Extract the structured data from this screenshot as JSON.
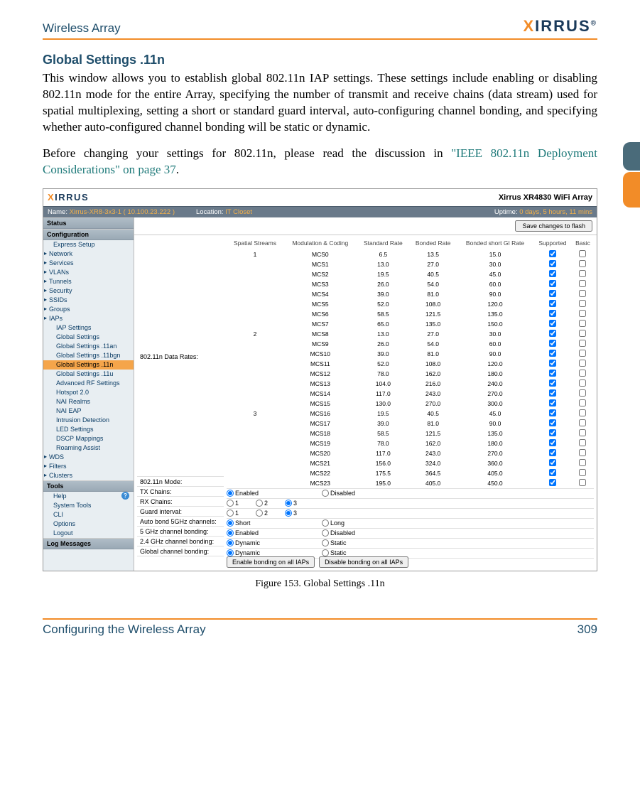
{
  "header": {
    "left": "Wireless Array",
    "brand_pre": "X",
    "brand_rest": "IRRUS",
    "brand_mark": "®"
  },
  "section_title": "Global Settings .11n",
  "para1": "This window allows you to establish global 802.11n IAP settings. These settings include enabling or disabling 802.11n mode for the entire Array, specifying the number of transmit and receive chains (data stream) used for spatial multiplexing, setting a short or standard guard interval, auto-configuring channel bonding, and specifying whether auto-configured channel bonding will be static or dynamic.",
  "para2_pre": "Before changing your settings for 802.11n, please read the discussion in ",
  "para2_link": "\"IEEE 802.11n Deployment Considerations\" on page 37",
  "para2_post": ".",
  "caption": "Figure 153. Global Settings .11n",
  "footer": {
    "left": "Configuring the Wireless Array",
    "right": "309"
  },
  "fig": {
    "title": "Xirrus XR4830 WiFi Array",
    "brand_pre": "X",
    "brand_rest": "IRRUS",
    "status": {
      "name_lbl": "Name:",
      "name_val": "Xirrus-XR8-3x3-1   ( 10.100.23.222 )",
      "loc_lbl": "Location:",
      "loc_val": "IT Closet",
      "up_lbl": "Uptime:",
      "up_val": "0 days, 5 hours, 11 mins"
    },
    "save_btn": "Save changes to flash",
    "sidebar": {
      "hdr1": "Status",
      "hdr2": "Configuration",
      "hdr3": "Tools",
      "hdr4": "Log Messages",
      "config_top": [
        "Express Setup"
      ],
      "config_primary": [
        "Network",
        "Services",
        "VLANs",
        "Tunnels",
        "Security",
        "SSIDs",
        "Groups",
        "IAPs"
      ],
      "iap_sub": [
        "IAP Settings",
        "Global Settings",
        "Global Settings .11an",
        "Global Settings .11bgn",
        "Global Settings .11n",
        "Global Settings .11u",
        "Advanced RF Settings",
        "Hotspot 2.0",
        "NAI Realms",
        "NAI EAP",
        "Intrusion Detection",
        "LED Settings",
        "DSCP Mappings",
        "Roaming Assist"
      ],
      "after_iaps": [
        "WDS",
        "Filters",
        "Clusters"
      ],
      "tools": [
        "Help",
        "System Tools",
        "CLI",
        "Options",
        "Logout"
      ]
    },
    "rates_label": "802.11n Data Rates:",
    "headers": [
      "Spatial Streams",
      "Modulation & Coding",
      "Standard Rate",
      "Bonded Rate",
      "Bonded short GI Rate",
      "Supported",
      "Basic"
    ],
    "rows": [
      {
        "ss": "1",
        "mc": "MCS0",
        "sr": "6.5",
        "br": "13.5",
        "bg": "15.0",
        "sup": true,
        "bas": false
      },
      {
        "ss": "",
        "mc": "MCS1",
        "sr": "13.0",
        "br": "27.0",
        "bg": "30.0",
        "sup": true,
        "bas": false
      },
      {
        "ss": "",
        "mc": "MCS2",
        "sr": "19.5",
        "br": "40.5",
        "bg": "45.0",
        "sup": true,
        "bas": false
      },
      {
        "ss": "",
        "mc": "MCS3",
        "sr": "26.0",
        "br": "54.0",
        "bg": "60.0",
        "sup": true,
        "bas": false
      },
      {
        "ss": "",
        "mc": "MCS4",
        "sr": "39.0",
        "br": "81.0",
        "bg": "90.0",
        "sup": true,
        "bas": false
      },
      {
        "ss": "",
        "mc": "MCS5",
        "sr": "52.0",
        "br": "108.0",
        "bg": "120.0",
        "sup": true,
        "bas": false
      },
      {
        "ss": "",
        "mc": "MCS6",
        "sr": "58.5",
        "br": "121.5",
        "bg": "135.0",
        "sup": true,
        "bas": false
      },
      {
        "ss": "",
        "mc": "MCS7",
        "sr": "65.0",
        "br": "135.0",
        "bg": "150.0",
        "sup": true,
        "bas": false
      },
      {
        "ss": "2",
        "mc": "MCS8",
        "sr": "13.0",
        "br": "27.0",
        "bg": "30.0",
        "sup": true,
        "bas": false
      },
      {
        "ss": "",
        "mc": "MCS9",
        "sr": "26.0",
        "br": "54.0",
        "bg": "60.0",
        "sup": true,
        "bas": false
      },
      {
        "ss": "",
        "mc": "MCS10",
        "sr": "39.0",
        "br": "81.0",
        "bg": "90.0",
        "sup": true,
        "bas": false
      },
      {
        "ss": "",
        "mc": "MCS11",
        "sr": "52.0",
        "br": "108.0",
        "bg": "120.0",
        "sup": true,
        "bas": false
      },
      {
        "ss": "",
        "mc": "MCS12",
        "sr": "78.0",
        "br": "162.0",
        "bg": "180.0",
        "sup": true,
        "bas": false
      },
      {
        "ss": "",
        "mc": "MCS13",
        "sr": "104.0",
        "br": "216.0",
        "bg": "240.0",
        "sup": true,
        "bas": false
      },
      {
        "ss": "",
        "mc": "MCS14",
        "sr": "117.0",
        "br": "243.0",
        "bg": "270.0",
        "sup": true,
        "bas": false
      },
      {
        "ss": "",
        "mc": "MCS15",
        "sr": "130.0",
        "br": "270.0",
        "bg": "300.0",
        "sup": true,
        "bas": false
      },
      {
        "ss": "3",
        "mc": "MCS16",
        "sr": "19.5",
        "br": "40.5",
        "bg": "45.0",
        "sup": true,
        "bas": false
      },
      {
        "ss": "",
        "mc": "MCS17",
        "sr": "39.0",
        "br": "81.0",
        "bg": "90.0",
        "sup": true,
        "bas": false
      },
      {
        "ss": "",
        "mc": "MCS18",
        "sr": "58.5",
        "br": "121.5",
        "bg": "135.0",
        "sup": true,
        "bas": false
      },
      {
        "ss": "",
        "mc": "MCS19",
        "sr": "78.0",
        "br": "162.0",
        "bg": "180.0",
        "sup": true,
        "bas": false
      },
      {
        "ss": "",
        "mc": "MCS20",
        "sr": "117.0",
        "br": "243.0",
        "bg": "270.0",
        "sup": true,
        "bas": false
      },
      {
        "ss": "",
        "mc": "MCS21",
        "sr": "156.0",
        "br": "324.0",
        "bg": "360.0",
        "sup": true,
        "bas": false
      },
      {
        "ss": "",
        "mc": "MCS22",
        "sr": "175.5",
        "br": "364.5",
        "bg": "405.0",
        "sup": true,
        "bas": false
      },
      {
        "ss": "",
        "mc": "MCS23",
        "sr": "195.0",
        "br": "405.0",
        "bg": "450.0",
        "sup": true,
        "bas": false
      }
    ],
    "controls": [
      {
        "label": "802.11n Mode:",
        "type": "radio2",
        "o1": "Enabled",
        "o2": "Disabled",
        "sel": 0
      },
      {
        "label": "TX Chains:",
        "type": "radio3",
        "o1": "1",
        "o2": "2",
        "o3": "3",
        "sel": 2
      },
      {
        "label": "RX Chains:",
        "type": "radio3",
        "o1": "1",
        "o2": "2",
        "o3": "3",
        "sel": 2
      },
      {
        "label": "Guard interval:",
        "type": "radio2",
        "o1": "Short",
        "o2": "Long",
        "sel": 0
      },
      {
        "label": "Auto bond 5GHz channels:",
        "type": "radio2",
        "o1": "Enabled",
        "o2": "Disabled",
        "sel": 0
      },
      {
        "label": "5 GHz channel bonding:",
        "type": "radio2",
        "o1": "Dynamic",
        "o2": "Static",
        "sel": 0
      },
      {
        "label": "2.4 GHz channel bonding:",
        "type": "radio2",
        "o1": "Dynamic",
        "o2": "Static",
        "sel": 0
      }
    ],
    "bonding": {
      "label": "Global channel bonding:",
      "btn1": "Enable bonding on all IAPs",
      "btn2": "Disable bonding on all IAPs"
    }
  }
}
